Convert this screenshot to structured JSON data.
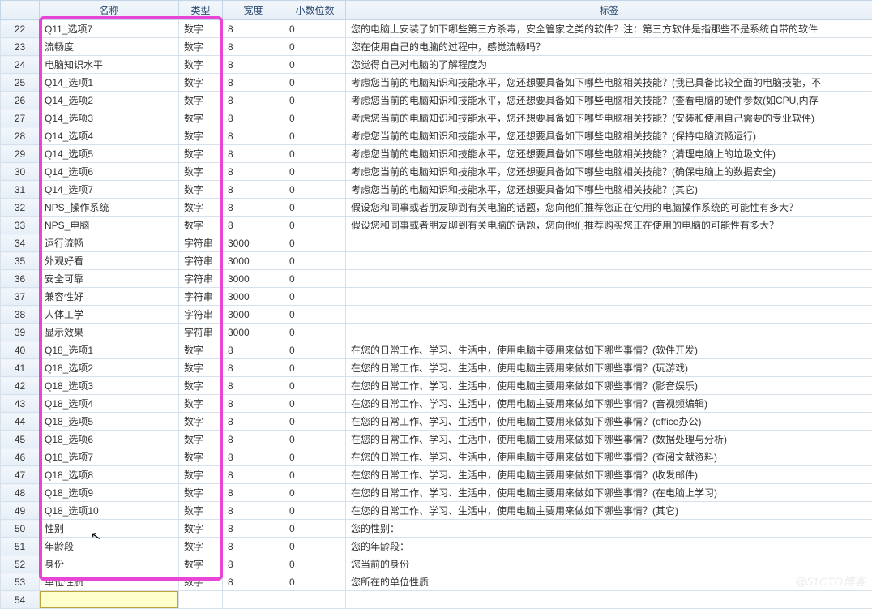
{
  "headers": {
    "name": "名称",
    "type": "类型",
    "width": "宽度",
    "decimals": "小数位数",
    "label": "标签"
  },
  "rows": [
    {
      "n": 22,
      "name": "Q11_选项7",
      "type": "数字",
      "width": "8",
      "dec": "0",
      "label": "您的电脑上安装了如下哪些第三方杀毒，安全管家之类的软件？注：第三方软件是指那些不是系统自带的软件"
    },
    {
      "n": 23,
      "name": "流畅度",
      "type": "数字",
      "width": "8",
      "dec": "0",
      "label": "您在使用自己的电脑的过程中，感觉流畅吗？"
    },
    {
      "n": 24,
      "name": "电脑知识水平",
      "type": "数字",
      "width": "8",
      "dec": "0",
      "label": "您觉得自己对电脑的了解程度为"
    },
    {
      "n": 25,
      "name": "Q14_选项1",
      "type": "数字",
      "width": "8",
      "dec": "0",
      "label": "考虑您当前的电脑知识和技能水平，您还想要具备如下哪些电脑相关技能？(我已具备比较全面的电脑技能，不"
    },
    {
      "n": 26,
      "name": "Q14_选项2",
      "type": "数字",
      "width": "8",
      "dec": "0",
      "label": "考虑您当前的电脑知识和技能水平，您还想要具备如下哪些电脑相关技能？(查看电脑的硬件参数(如CPU,内存"
    },
    {
      "n": 27,
      "name": "Q14_选项3",
      "type": "数字",
      "width": "8",
      "dec": "0",
      "label": "考虑您当前的电脑知识和技能水平，您还想要具备如下哪些电脑相关技能？(安装和使用自己需要的专业软件)"
    },
    {
      "n": 28,
      "name": "Q14_选项4",
      "type": "数字",
      "width": "8",
      "dec": "0",
      "label": "考虑您当前的电脑知识和技能水平，您还想要具备如下哪些电脑相关技能？(保持电脑流畅运行)"
    },
    {
      "n": 29,
      "name": "Q14_选项5",
      "type": "数字",
      "width": "8",
      "dec": "0",
      "label": "考虑您当前的电脑知识和技能水平，您还想要具备如下哪些电脑相关技能？(清理电脑上的垃圾文件)"
    },
    {
      "n": 30,
      "name": "Q14_选项6",
      "type": "数字",
      "width": "8",
      "dec": "0",
      "label": "考虑您当前的电脑知识和技能水平，您还想要具备如下哪些电脑相关技能？(确保电脑上的数据安全)"
    },
    {
      "n": 31,
      "name": "Q14_选项7",
      "type": "数字",
      "width": "8",
      "dec": "0",
      "label": "考虑您当前的电脑知识和技能水平，您还想要具备如下哪些电脑相关技能？(其它)"
    },
    {
      "n": 32,
      "name": "NPS_操作系统",
      "type": "数字",
      "width": "8",
      "dec": "0",
      "label": "假设您和同事或者朋友聊到有关电脑的话题，您向他们推荐您正在使用的电脑操作系统的可能性有多大？"
    },
    {
      "n": 33,
      "name": "NPS_电脑",
      "type": "数字",
      "width": "8",
      "dec": "0",
      "label": "假设您和同事或者朋友聊到有关电脑的话题，您向他们推荐购买您正在使用的电脑的可能性有多大？"
    },
    {
      "n": 34,
      "name": "运行流畅",
      "type": "字符串",
      "width": "3000",
      "dec": "0",
      "label": ""
    },
    {
      "n": 35,
      "name": "外观好看",
      "type": "字符串",
      "width": "3000",
      "dec": "0",
      "label": ""
    },
    {
      "n": 36,
      "name": "安全可靠",
      "type": "字符串",
      "width": "3000",
      "dec": "0",
      "label": ""
    },
    {
      "n": 37,
      "name": "兼容性好",
      "type": "字符串",
      "width": "3000",
      "dec": "0",
      "label": ""
    },
    {
      "n": 38,
      "name": "人体工学",
      "type": "字符串",
      "width": "3000",
      "dec": "0",
      "label": ""
    },
    {
      "n": 39,
      "name": "显示效果",
      "type": "字符串",
      "width": "3000",
      "dec": "0",
      "label": ""
    },
    {
      "n": 40,
      "name": "Q18_选项1",
      "type": "数字",
      "width": "8",
      "dec": "0",
      "label": "在您的日常工作、学习、生活中，使用电脑主要用来做如下哪些事情？(软件开发)"
    },
    {
      "n": 41,
      "name": "Q18_选项2",
      "type": "数字",
      "width": "8",
      "dec": "0",
      "label": "在您的日常工作、学习、生活中，使用电脑主要用来做如下哪些事情？(玩游戏)"
    },
    {
      "n": 42,
      "name": "Q18_选项3",
      "type": "数字",
      "width": "8",
      "dec": "0",
      "label": "在您的日常工作、学习、生活中，使用电脑主要用来做如下哪些事情？(影音娱乐)"
    },
    {
      "n": 43,
      "name": "Q18_选项4",
      "type": "数字",
      "width": "8",
      "dec": "0",
      "label": "在您的日常工作、学习、生活中，使用电脑主要用来做如下哪些事情？(音视频编辑)"
    },
    {
      "n": 44,
      "name": "Q18_选项5",
      "type": "数字",
      "width": "8",
      "dec": "0",
      "label": "在您的日常工作、学习、生活中，使用电脑主要用来做如下哪些事情？(office办公)"
    },
    {
      "n": 45,
      "name": "Q18_选项6",
      "type": "数字",
      "width": "8",
      "dec": "0",
      "label": "在您的日常工作、学习、生活中，使用电脑主要用来做如下哪些事情？(数据处理与分析)"
    },
    {
      "n": 46,
      "name": "Q18_选项7",
      "type": "数字",
      "width": "8",
      "dec": "0",
      "label": "在您的日常工作、学习、生活中，使用电脑主要用来做如下哪些事情？(查阅文献资料)"
    },
    {
      "n": 47,
      "name": "Q18_选项8",
      "type": "数字",
      "width": "8",
      "dec": "0",
      "label": "在您的日常工作、学习、生活中，使用电脑主要用来做如下哪些事情？(收发邮件)"
    },
    {
      "n": 48,
      "name": "Q18_选项9",
      "type": "数字",
      "width": "8",
      "dec": "0",
      "label": "在您的日常工作、学习、生活中，使用电脑主要用来做如下哪些事情？(在电脑上学习)"
    },
    {
      "n": 49,
      "name": "Q18_选项10",
      "type": "数字",
      "width": "8",
      "dec": "0",
      "label": "在您的日常工作、学习、生活中，使用电脑主要用来做如下哪些事情？(其它)"
    },
    {
      "n": 50,
      "name": "性别",
      "type": "数字",
      "width": "8",
      "dec": "0",
      "label": "您的性别："
    },
    {
      "n": 51,
      "name": "年龄段",
      "type": "数字",
      "width": "8",
      "dec": "0",
      "label": "您的年龄段："
    },
    {
      "n": 52,
      "name": "身份",
      "type": "数字",
      "width": "8",
      "dec": "0",
      "label": "您当前的身份"
    },
    {
      "n": 53,
      "name": "单位性质",
      "type": "数字",
      "width": "8",
      "dec": "0",
      "label": "您所在的单位性质"
    },
    {
      "n": 54,
      "name": "",
      "type": "",
      "width": "",
      "dec": "",
      "label": ""
    }
  ],
  "watermark": "@51CTO博客"
}
